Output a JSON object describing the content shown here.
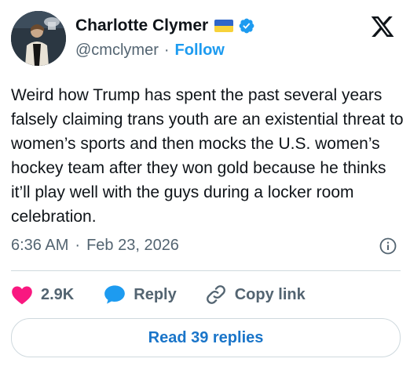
{
  "author": {
    "display_name": "Charlotte Clymer",
    "handle": "@cmclymer",
    "follow_label": "Follow",
    "separator": "·",
    "flag_colors": {
      "top": "#2f66c9",
      "bottom": "#f7d23a"
    },
    "verified_color": "#1d9bf0"
  },
  "tweet": {
    "text": "Weird how Trump has spent the past several years falsely claiming trans youth are an existential threat to women’s sports and then mocks the U.S. women’s hockey team after they won gold because he thinks it’ll play well with the guys during a locker room celebration.",
    "time": "6:36 AM",
    "separator": "·",
    "date": "Feb 23, 2026"
  },
  "actions": {
    "like_count": "2.9K",
    "reply_label": "Reply",
    "copy_link_label": "Copy link"
  },
  "footer": {
    "read_replies_label": "Read 39 replies"
  },
  "colors": {
    "like": "#f91880",
    "reply": "#1d9bf0",
    "accent": "#1d9bf0",
    "muted": "#536471",
    "text": "#0f1419",
    "divider": "#cfd9de"
  },
  "icons": [
    "x-logo-icon",
    "verified-badge-icon",
    "heart-icon",
    "reply-bubble-icon",
    "link-icon",
    "info-icon"
  ]
}
